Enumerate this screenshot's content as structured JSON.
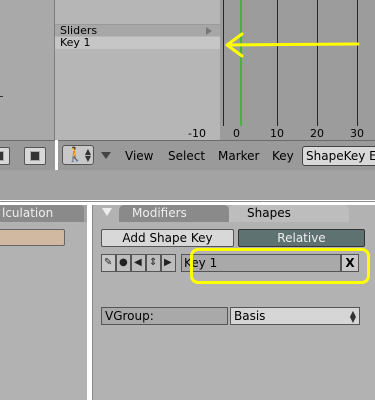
{
  "channels": {
    "sliders_label": "Sliders",
    "key_label": "Key 1"
  },
  "timeline": {
    "ruler_ticks": [
      "-10",
      "0",
      "10",
      "20",
      "30"
    ],
    "current_frame_color": "#44b43a",
    "annotation_color": "#ffff00"
  },
  "toolbar": {
    "menus": [
      "View",
      "Select",
      "Marker",
      "Key"
    ],
    "shapekey_button": "ShapeKey E"
  },
  "panels": {
    "left_tab": "lculation",
    "modifiers_tab": "Modifiers",
    "shapes_tab": "Shapes"
  },
  "shapes": {
    "add_shape_key": "Add Shape Key",
    "relative": "Relative",
    "key_name": "Key 1",
    "delete": "X",
    "vgroup_label": "VGroup:",
    "basis": "Basis",
    "relative_color": "#5f7272"
  }
}
